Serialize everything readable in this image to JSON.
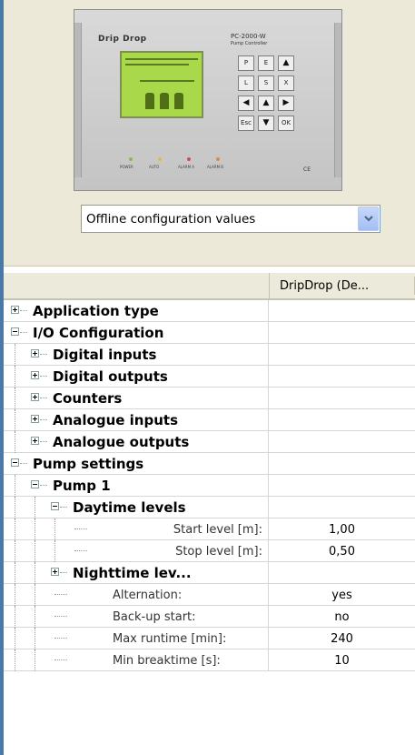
{
  "device": {
    "brand": "Drip Drop",
    "model": "PC-2000-W",
    "model_sub": "Pump Controller",
    "keys": [
      "P",
      "E",
      "▲",
      "L",
      "S",
      "X",
      "◀",
      "▲",
      "▶",
      "Esc",
      "▼",
      "OK"
    ],
    "leds": [
      {
        "label": "POWER",
        "color": "#7bc043"
      },
      {
        "label": "AUTO",
        "color": "#e0c030"
      },
      {
        "label": "ALARM A",
        "color": "#d94a4a"
      },
      {
        "label": "ALARM B",
        "color": "#d98a4a"
      }
    ],
    "ce": "CE"
  },
  "config_select": {
    "value": "Offline configuration values"
  },
  "grid": {
    "columns": [
      "",
      "DripDrop (De..."
    ],
    "rows": [
      {
        "label": "Application type",
        "kind": "group",
        "level": 0,
        "toggle": "+",
        "value": ""
      },
      {
        "label": "I/O Configuration",
        "kind": "group",
        "level": 0,
        "toggle": "-",
        "value": ""
      },
      {
        "label": "Digital inputs",
        "kind": "group",
        "level": 1,
        "toggle": "+",
        "value": ""
      },
      {
        "label": "Digital outputs",
        "kind": "group",
        "level": 1,
        "toggle": "+",
        "value": ""
      },
      {
        "label": "Counters",
        "kind": "group",
        "level": 1,
        "toggle": "+",
        "value": ""
      },
      {
        "label": "Analogue inputs",
        "kind": "group",
        "level": 1,
        "toggle": "+",
        "value": ""
      },
      {
        "label": "Analogue outputs",
        "kind": "group",
        "level": 1,
        "toggle": "+",
        "value": ""
      },
      {
        "label": "Pump settings",
        "kind": "group",
        "level": 0,
        "toggle": "-",
        "value": ""
      },
      {
        "label": "Pump 1",
        "kind": "group",
        "level": 1,
        "toggle": "-",
        "value": ""
      },
      {
        "label": "Daytime levels",
        "kind": "group",
        "level": 2,
        "toggle": "-",
        "value": ""
      },
      {
        "label": "Start level [m]:",
        "kind": "param",
        "level": 3,
        "toggle": "",
        "value": "1,00"
      },
      {
        "label": "Stop level [m]:",
        "kind": "param",
        "level": 3,
        "toggle": "",
        "value": "0,50"
      },
      {
        "label": "Nighttime lev...",
        "kind": "group",
        "level": 2,
        "toggle": "+",
        "value": ""
      },
      {
        "label": "Alternation:",
        "kind": "param",
        "level": 2,
        "toggle": "",
        "value": "yes"
      },
      {
        "label": "Back-up start:",
        "kind": "param",
        "level": 2,
        "toggle": "",
        "value": "no"
      },
      {
        "label": "Max runtime [min]:",
        "kind": "param",
        "level": 2,
        "toggle": "",
        "value": "240"
      },
      {
        "label": "Min breaktime [s]:",
        "kind": "param",
        "level": 2,
        "toggle": "",
        "value": "10"
      }
    ]
  }
}
